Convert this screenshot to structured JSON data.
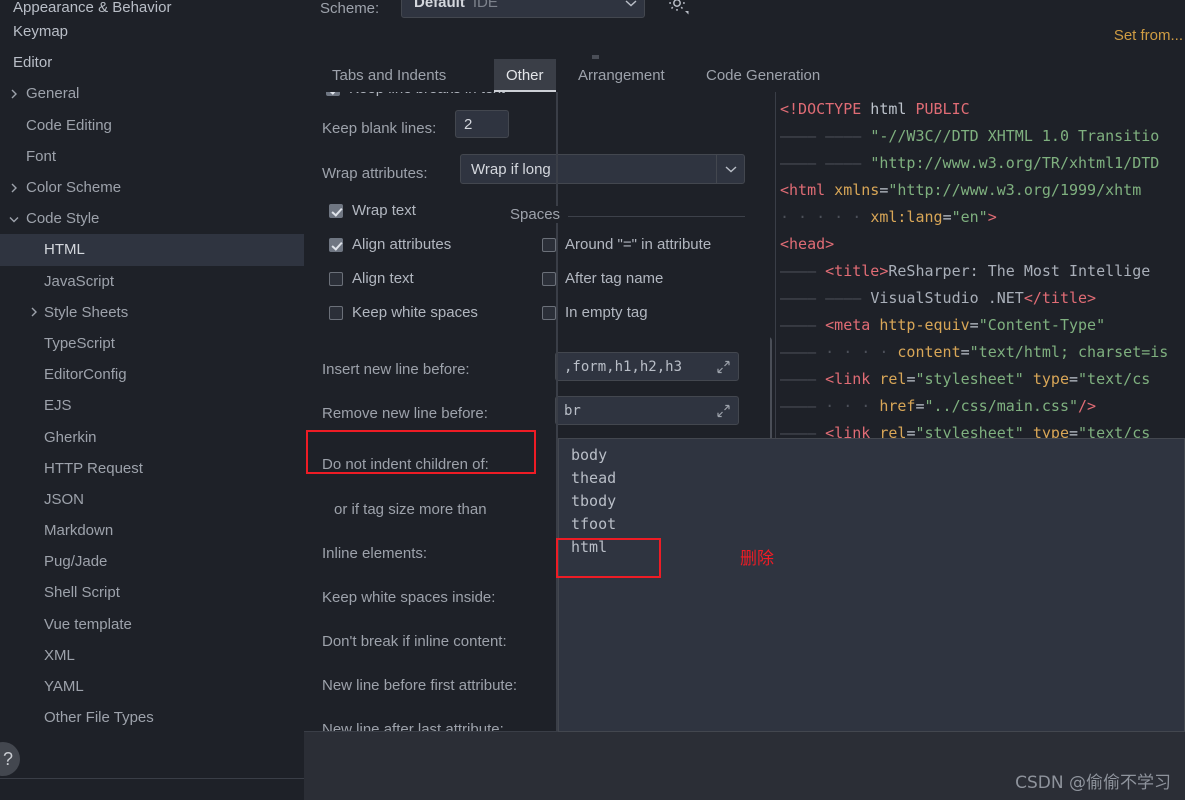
{
  "window": {
    "app": "IntelliJ IDEA Settings",
    "accent_gold": "#cf9c43",
    "annotation_red": "#ee1c25",
    "selection_bg": "#2f3440",
    "panel_bg": "#1e2128"
  },
  "sidebar": {
    "items": [
      {
        "label": "Appearance & Behavior",
        "level": 0,
        "arrow": "none",
        "selected": false,
        "clipped": true
      },
      {
        "label": "Keymap",
        "level": 0,
        "arrow": "none",
        "selected": false
      },
      {
        "label": "Editor",
        "level": 0,
        "arrow": "none",
        "selected": false
      },
      {
        "label": "General",
        "level": 1,
        "arrow": "right",
        "selected": false
      },
      {
        "label": "Code Editing",
        "level": 1,
        "arrow": "none",
        "selected": false
      },
      {
        "label": "Font",
        "level": 1,
        "arrow": "none",
        "selected": false
      },
      {
        "label": "Color Scheme",
        "level": 1,
        "arrow": "right",
        "selected": false
      },
      {
        "label": "Code Style",
        "level": 1,
        "arrow": "down",
        "selected": false
      },
      {
        "label": "HTML",
        "level": 2,
        "arrow": "none",
        "selected": true
      },
      {
        "label": "JavaScript",
        "level": 2,
        "arrow": "none",
        "selected": false
      },
      {
        "label": "Style Sheets",
        "level": 2,
        "arrow": "right",
        "selected": false
      },
      {
        "label": "TypeScript",
        "level": 2,
        "arrow": "none",
        "selected": false
      },
      {
        "label": "EditorConfig",
        "level": 2,
        "arrow": "none",
        "selected": false
      },
      {
        "label": "EJS",
        "level": 2,
        "arrow": "none",
        "selected": false
      },
      {
        "label": "Gherkin",
        "level": 2,
        "arrow": "none",
        "selected": false
      },
      {
        "label": "HTTP Request",
        "level": 2,
        "arrow": "none",
        "selected": false
      },
      {
        "label": "JSON",
        "level": 2,
        "arrow": "none",
        "selected": false
      },
      {
        "label": "Markdown",
        "level": 2,
        "arrow": "none",
        "selected": false
      },
      {
        "label": "Pug/Jade",
        "level": 2,
        "arrow": "none",
        "selected": false
      },
      {
        "label": "Shell Script",
        "level": 2,
        "arrow": "none",
        "selected": false
      },
      {
        "label": "Vue template",
        "level": 2,
        "arrow": "none",
        "selected": false
      },
      {
        "label": "XML",
        "level": 2,
        "arrow": "none",
        "selected": false
      },
      {
        "label": "YAML",
        "level": 2,
        "arrow": "none",
        "selected": false
      },
      {
        "label": "Other File Types",
        "level": 2,
        "arrow": "none",
        "selected": false
      }
    ],
    "help_button": "?"
  },
  "scheme_bar": {
    "label": "Scheme:",
    "value": "Default",
    "value_suffix": "IDE",
    "gear_icon": "gear-icon",
    "set_from_link": "Set from..."
  },
  "tabs": [
    {
      "label": "Tabs and Indents",
      "active": false
    },
    {
      "label": "Other",
      "active": true
    },
    {
      "label": "Arrangement",
      "active": false
    },
    {
      "label": "Code Generation",
      "active": false
    }
  ],
  "settings": {
    "clipped_row": {
      "label": "Keep line breaks in text",
      "checked": true
    },
    "keep_blank_lines": {
      "label": "Keep blank lines:",
      "value": "2"
    },
    "wrap_attributes": {
      "label": "Wrap attributes:",
      "value": "Wrap if long"
    },
    "checkboxes_left": [
      {
        "label": "Wrap text",
        "checked": true
      },
      {
        "label": "Align attributes",
        "checked": true
      },
      {
        "label": "Align text",
        "checked": false
      },
      {
        "label": "Keep white spaces",
        "checked": false
      }
    ],
    "spaces_group": {
      "title": "Spaces",
      "checkboxes": [
        {
          "label": "Around \"=\" in attribute",
          "checked": false
        },
        {
          "label": "After tag name",
          "checked": false
        },
        {
          "label": "In empty tag",
          "checked": false
        }
      ]
    },
    "fields": [
      {
        "label": "Insert new line before:",
        "value": ",form,h1,h2,h3",
        "expander": "expand-icon"
      },
      {
        "label": "Remove new line before:",
        "value": "br",
        "expander": "expand-icon"
      }
    ],
    "labels_only": [
      "Do not indent children of:",
      "or if tag size more than",
      "Inline elements:",
      "Keep white spaces inside:",
      "Don't break if inline content:",
      "New line before first attribute:",
      "New line after last attribute:"
    ],
    "list_items": [
      "body",
      "thead",
      "tbody",
      "tfoot",
      "html"
    ]
  },
  "code_preview": {
    "lines": [
      [
        {
          "t": "tag",
          "s": "<!DOCTYPE"
        },
        {
          "t": "plain",
          "s": " html "
        },
        {
          "t": "tag",
          "s": "PUBLIC"
        }
      ],
      [
        {
          "t": "ind",
          "s": "———— ———— "
        },
        {
          "t": "val",
          "s": "\"-//W3C//DTD XHTML 1.0 Transitio"
        }
      ],
      [
        {
          "t": "ind",
          "s": "———— ———— "
        },
        {
          "t": "val",
          "s": "\"http://www.w3.org/TR/xhtml1/DTD"
        }
      ],
      [
        {
          "t": "tag",
          "s": "<html"
        },
        {
          "t": "attr",
          "s": " xmlns"
        },
        {
          "t": "plain",
          "s": "="
        },
        {
          "t": "val",
          "s": "\"http://www.w3.org/1999/xhtm"
        }
      ],
      [
        {
          "t": "ind",
          "s": "· · · · · "
        },
        {
          "t": "attr",
          "s": "xml:lang"
        },
        {
          "t": "plain",
          "s": "="
        },
        {
          "t": "val",
          "s": "\"en\""
        },
        {
          "t": "tag",
          "s": ">"
        }
      ],
      [
        {
          "t": "tag",
          "s": "<head>"
        }
      ],
      [
        {
          "t": "ind",
          "s": "———— "
        },
        {
          "t": "tag",
          "s": "<title>"
        },
        {
          "t": "txt",
          "s": "ReSharper: The Most Intellige"
        }
      ],
      [
        {
          "t": "ind",
          "s": "———— ———— "
        },
        {
          "t": "txt",
          "s": "VisualStudio .NET"
        },
        {
          "t": "tag",
          "s": "</title>"
        }
      ],
      [
        {
          "t": "ind",
          "s": "———— "
        },
        {
          "t": "tag",
          "s": "<meta"
        },
        {
          "t": "attr",
          "s": " http-equiv"
        },
        {
          "t": "plain",
          "s": "="
        },
        {
          "t": "val",
          "s": "\"Content-Type\""
        }
      ],
      [
        {
          "t": "ind",
          "s": "———— · · · · "
        },
        {
          "t": "attr",
          "s": "content"
        },
        {
          "t": "plain",
          "s": "="
        },
        {
          "t": "val",
          "s": "\"text/html; charset=is"
        }
      ],
      [
        {
          "t": "ind",
          "s": "———— "
        },
        {
          "t": "tag",
          "s": "<link"
        },
        {
          "t": "attr",
          "s": " rel"
        },
        {
          "t": "plain",
          "s": "="
        },
        {
          "t": "val",
          "s": "\"stylesheet\""
        },
        {
          "t": "attr",
          "s": " type"
        },
        {
          "t": "plain",
          "s": "="
        },
        {
          "t": "val",
          "s": "\"text/cs"
        }
      ],
      [
        {
          "t": "ind",
          "s": "———— · · · "
        },
        {
          "t": "attr",
          "s": "href"
        },
        {
          "t": "plain",
          "s": "="
        },
        {
          "t": "val",
          "s": "\"../css/main.css\""
        },
        {
          "t": "tag",
          "s": "/>"
        }
      ],
      [
        {
          "t": "ind",
          "s": "———— "
        },
        {
          "t": "tag",
          "s": "<link"
        },
        {
          "t": "attr",
          "s": " rel"
        },
        {
          "t": "plain",
          "s": "="
        },
        {
          "t": "val",
          "s": "\"stylesheet\""
        },
        {
          "t": "attr",
          "s": " type"
        },
        {
          "t": "plain",
          "s": "="
        },
        {
          "t": "val",
          "s": "\"text/cs"
        }
      ]
    ]
  },
  "annotations": {
    "delete_text": "删除",
    "boxed_label": "Do not indent children of:",
    "boxed_list_item": "html"
  },
  "watermark": "CSDN @偷偷不学习"
}
